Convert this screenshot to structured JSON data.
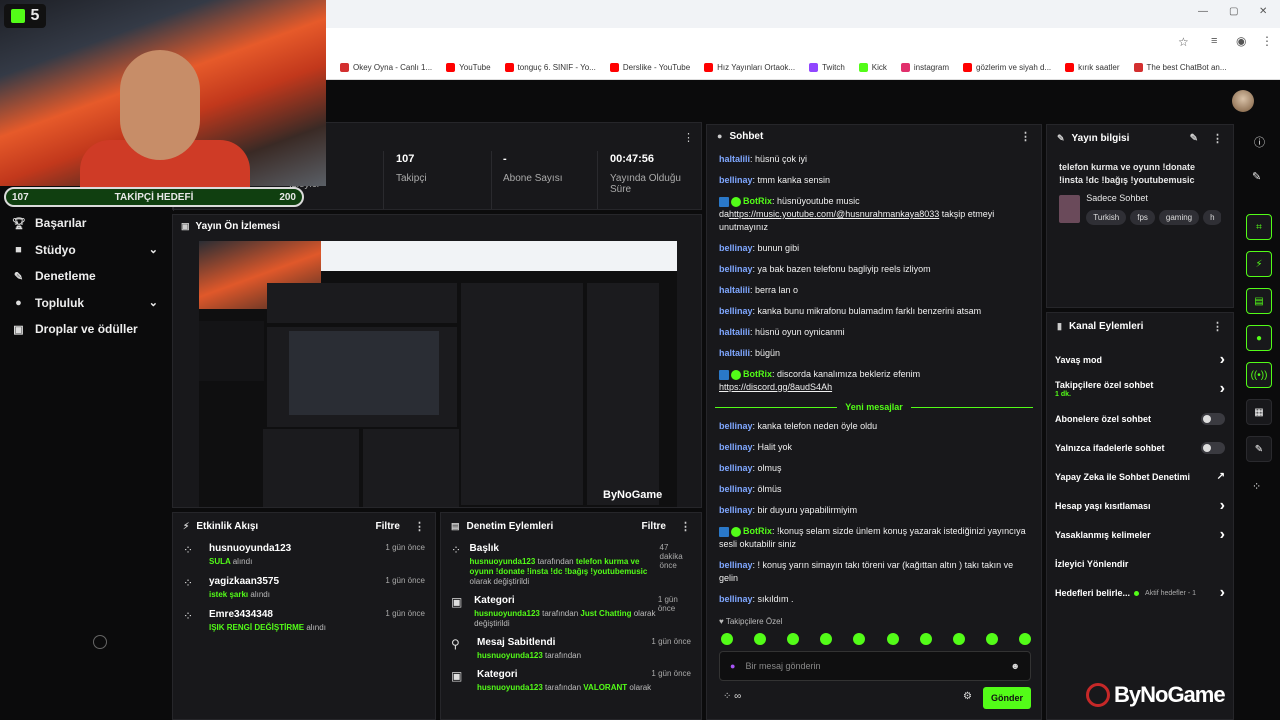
{
  "browser": {
    "bookmarks": [
      {
        "label": "Okey Oyna - Canlı 1...",
        "color": "#d32f2f"
      },
      {
        "label": "YouTube",
        "color": "#ff0000"
      },
      {
        "label": "tonguç 6. SINIF - Yo...",
        "color": "#ff0000"
      },
      {
        "label": "Derslike - YouTube",
        "color": "#ff0000"
      },
      {
        "label": "Hız Yayınları Ortaok...",
        "color": "#ff0000"
      },
      {
        "label": "Twitch",
        "color": "#9146ff"
      },
      {
        "label": "Kick",
        "color": "#53fc18"
      },
      {
        "label": "instagram",
        "color": "#e1306c"
      },
      {
        "label": "gözlerim ve siyah d...",
        "color": "#ff0000"
      },
      {
        "label": "kırık saatler",
        "color": "#ff0000"
      },
      {
        "label": "The best ChatBot an...",
        "color": "#d32f2f"
      }
    ]
  },
  "overlay": {
    "kick_count": "5",
    "follow_current": "107",
    "follow_label": "TAKİPÇİ HEDEFİ",
    "follow_target": "200",
    "follow_progress": 0.535
  },
  "sidebar": {
    "items": [
      {
        "label": "Başarılar",
        "icon": "trophy-icon",
        "chev": false
      },
      {
        "label": "Stüdyo",
        "icon": "camera-icon",
        "chev": true
      },
      {
        "label": "Denetleme",
        "icon": "wrench-icon",
        "chev": false
      },
      {
        "label": "Topluluk",
        "icon": "users-icon",
        "chev": true
      },
      {
        "label": "Droplar ve ödüller",
        "icon": "gift-icon",
        "chev": false
      }
    ]
  },
  "stats": {
    "items": [
      {
        "value": "107",
        "label": "Takipçi"
      },
      {
        "value": "-",
        "label": "Abone Sayısı"
      },
      {
        "value": "00:47:56",
        "label": "Yayında Olduğu Süre"
      }
    ],
    "partial_viewer_label": "İzleyici"
  },
  "preview": {
    "title": "Yayın Ön İzlemesi"
  },
  "activity": {
    "title": "Etkinlik Akışı",
    "filter": "Filtre",
    "events": [
      {
        "user": "husnuoyunda123",
        "action": "SULA",
        "suffix": "alındı",
        "time": "1 gün önce"
      },
      {
        "user": "yagizkaan3575",
        "action": "istek şarkı",
        "suffix": "alındı",
        "time": "1 gün önce"
      },
      {
        "user": "Emre3434348",
        "action": "IŞIK RENGİ DEĞİŞTİRME",
        "suffix": "alındı",
        "time": "1 gün önce"
      }
    ]
  },
  "moderation": {
    "title": "Denetim Eylemleri",
    "filter": "Filtre",
    "events": [
      {
        "title": "Başlık",
        "time": "47 dakika önce",
        "line1_user": "husnuoyunda123",
        "line1_mid": "tarafından",
        "line1_val": "telefon kurma ve oyunn !donate !insta !dc !bağış !youtubemusic",
        "line1_end": "olarak değiştirildi"
      },
      {
        "title": "Kategori",
        "time": "1 gün önce",
        "line1_user": "husnuoyunda123",
        "line1_mid": "tarafından",
        "line1_val": "Just Chatting",
        "line1_end": "olarak değiştirildi"
      },
      {
        "title": "Mesaj Sabitlendi",
        "time": "1 gün önce",
        "line1_user": "husnuoyunda123",
        "line1_mid": "tarafından",
        "line1_val": "",
        "line1_end": ""
      },
      {
        "title": "Kategori",
        "time": "1 gün önce",
        "line1_user": "husnuoyunda123",
        "line1_mid": "tarafından",
        "line1_val": "VALORANT",
        "line1_end": "olarak"
      }
    ]
  },
  "chat": {
    "title": "Sohbet",
    "messages_before": [
      {
        "user": "haltalili",
        "text": "hüsnü çok iyi",
        "bot": false
      },
      {
        "user": "bellinay",
        "text": "tmm kanka sensin",
        "bot": false
      },
      {
        "user": "BotRix",
        "text": "hüsnüyoutube music da",
        "link": "https://music.youtube.com/@husnurahmankaya8033",
        "after": " takşip etmeyi unutmayınız",
        "bot": true
      },
      {
        "user": "bellinay",
        "text": "bunun gibi",
        "bot": false
      },
      {
        "user": "bellinay",
        "text": "ya bak bazen telefonu bagliyip reels izliyom",
        "bot": false
      },
      {
        "user": "haltalili",
        "text": "berra lan o",
        "bot": false
      },
      {
        "user": "bellinay",
        "text": "kanka bunu mikrafonu bulamadım farklı benzerini atsam",
        "bot": false
      },
      {
        "user": "haltalili",
        "text": "hüsnü oyun oynicanmi",
        "bot": false
      },
      {
        "user": "haltalili",
        "text": "bügün",
        "bot": false
      },
      {
        "user": "BotRix",
        "text": "discorda kanalımıza bekleriz efenim ",
        "link": "https://discord.gg/8audS4Ah",
        "after": "",
        "bot": true
      }
    ],
    "new_messages_label": "Yeni mesajlar",
    "messages_after": [
      {
        "user": "bellinay",
        "text": "kanka telefon neden öyle oldu",
        "bot": false
      },
      {
        "user": "bellinay",
        "text": "Halit yok",
        "bot": false
      },
      {
        "user": "bellinay",
        "text": "olmuş",
        "bot": false
      },
      {
        "user": "bellinay",
        "text": "ölmüs",
        "bot": false
      },
      {
        "user": "bellinay",
        "text": "bir duyuru yapabilirmiyim",
        "bot": false
      },
      {
        "user": "BotRix",
        "text": "!konuş selam sizde ünlem konuş yazarak istediğinizi yayıncıya sesli okutabilir siniz",
        "bot": true
      },
      {
        "user": "bellinay",
        "text": "! konuş yarın simayın takı töreni var (kağıttan altın ) takı takın ve gelin",
        "bot": false
      },
      {
        "user": "bellinay",
        "text": "sıkıldım .",
        "bot": false
      }
    ],
    "follower_only_label": "Takipçilere Özel",
    "input_placeholder": "Bir mesaj gönderin",
    "send_label": "Gönder"
  },
  "stream_info": {
    "title": "Yayın bilgisi",
    "stream_title": "telefon kurma ve oyunn !donate !insta !dc !bağış !youtubemusic",
    "category": "Sadece Sohbet",
    "tags": [
      "Turkish",
      "fps",
      "gaming",
      "h"
    ]
  },
  "channel_actions": {
    "title": "Kanal Eylemleri",
    "items": [
      {
        "label": "Yavaş mod",
        "kind": "chev",
        "sub": ""
      },
      {
        "label": "Takipçilere özel sohbet",
        "kind": "chev",
        "sub": "1 dk."
      },
      {
        "label": "Abonelere özel sohbet",
        "kind": "toggle",
        "sub": ""
      },
      {
        "label": "Yalnızca ifadelerle sohbet",
        "kind": "toggle",
        "sub": ""
      },
      {
        "label": "Yapay Zeka ile Sohbet Denetimi",
        "kind": "ext",
        "sub": ""
      },
      {
        "label": "Hesap yaşı kısıtlaması",
        "kind": "chev",
        "sub": ""
      },
      {
        "label": "Yasaklanmış kelimeler",
        "kind": "chev",
        "sub": ""
      },
      {
        "label": "İzleyici Yönlendir",
        "kind": "none",
        "sub": ""
      },
      {
        "label": "Hedefleri belirle...",
        "kind": "chev",
        "sub": "Aktif hedefler - 1"
      }
    ]
  },
  "watermark": {
    "text": "ByNoGame"
  }
}
